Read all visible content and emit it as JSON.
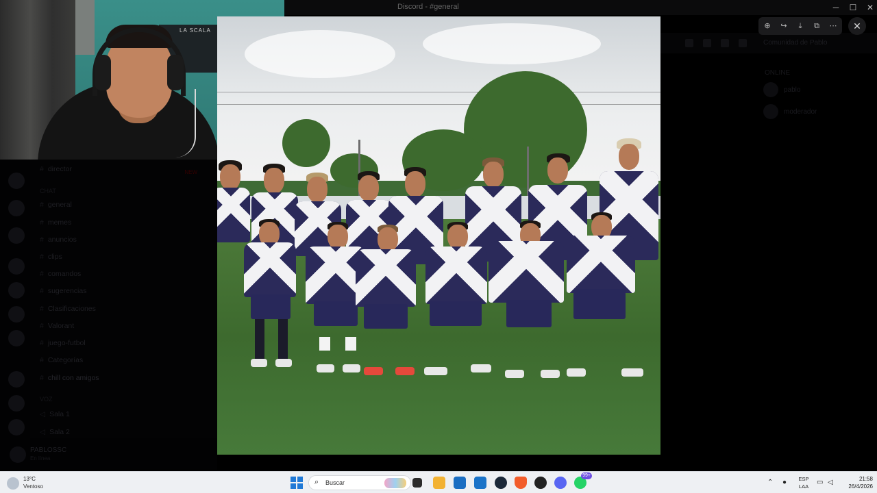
{
  "window": {
    "title": "Discord - #general",
    "minimize_glyph": "─",
    "maximize_glyph": "☐",
    "close_glyph": "✕"
  },
  "viewer": {
    "tools": [
      {
        "icon": "zoom-in-icon",
        "glyph": "⊕"
      },
      {
        "icon": "forward-icon",
        "glyph": "↪"
      },
      {
        "icon": "download-icon",
        "glyph": "⤓"
      },
      {
        "icon": "open-external-icon",
        "glyph": "⧉"
      },
      {
        "icon": "more-icon",
        "glyph": "⋯"
      }
    ],
    "close_glyph": "✕"
  },
  "background": {
    "server_name": "Comunidad de Pablo",
    "member_category": "ONLINE",
    "members": [
      "pablo",
      "moderador"
    ],
    "channels": [
      {
        "label": "director",
        "badge": "NEW"
      },
      {
        "label": "CHAT",
        "category": true
      },
      {
        "label": "general"
      },
      {
        "label": "memes"
      },
      {
        "label": "anuncios"
      },
      {
        "label": "clips"
      },
      {
        "label": "comandos"
      },
      {
        "label": "sugerencias"
      },
      {
        "label": "Clasificaciones"
      },
      {
        "label": "Valorant"
      },
      {
        "label": "juego-futbol"
      },
      {
        "label": "Categorías"
      },
      {
        "label": "chill con amigos",
        "active": true
      },
      {
        "label": "VOZ",
        "category": true
      },
      {
        "label": "Sala 1"
      },
      {
        "label": "Sala 2"
      }
    ],
    "user": {
      "name": "PABLOSSC",
      "status": "En línea"
    }
  },
  "webcam": {
    "flag_text": "LA SCALA"
  },
  "taskbar": {
    "weather_temp": "13°C",
    "weather_condition": "Ventoso",
    "search_placeholder": "Buscar",
    "apps": [
      {
        "icon": "task-view-icon",
        "color": "#2b2b2b"
      },
      {
        "icon": "file-explorer-icon",
        "color": "#f2b233"
      },
      {
        "icon": "microsoft-store-icon",
        "color": "#1b6ec2"
      },
      {
        "icon": "outlook-icon",
        "color": "#1a73c8"
      },
      {
        "icon": "steam-icon",
        "color": "#1b2838"
      },
      {
        "icon": "brave-icon",
        "color": "#f25c2a"
      },
      {
        "icon": "media-icon",
        "color": "#222222"
      },
      {
        "icon": "discord-icon",
        "color": "#5865f2"
      },
      {
        "icon": "whatsapp-icon",
        "color": "#25d366",
        "badge": "99+"
      }
    ],
    "lang_top": "ESP",
    "lang_bottom": "LAA",
    "time": "21:58",
    "date": "26/4/2026"
  }
}
